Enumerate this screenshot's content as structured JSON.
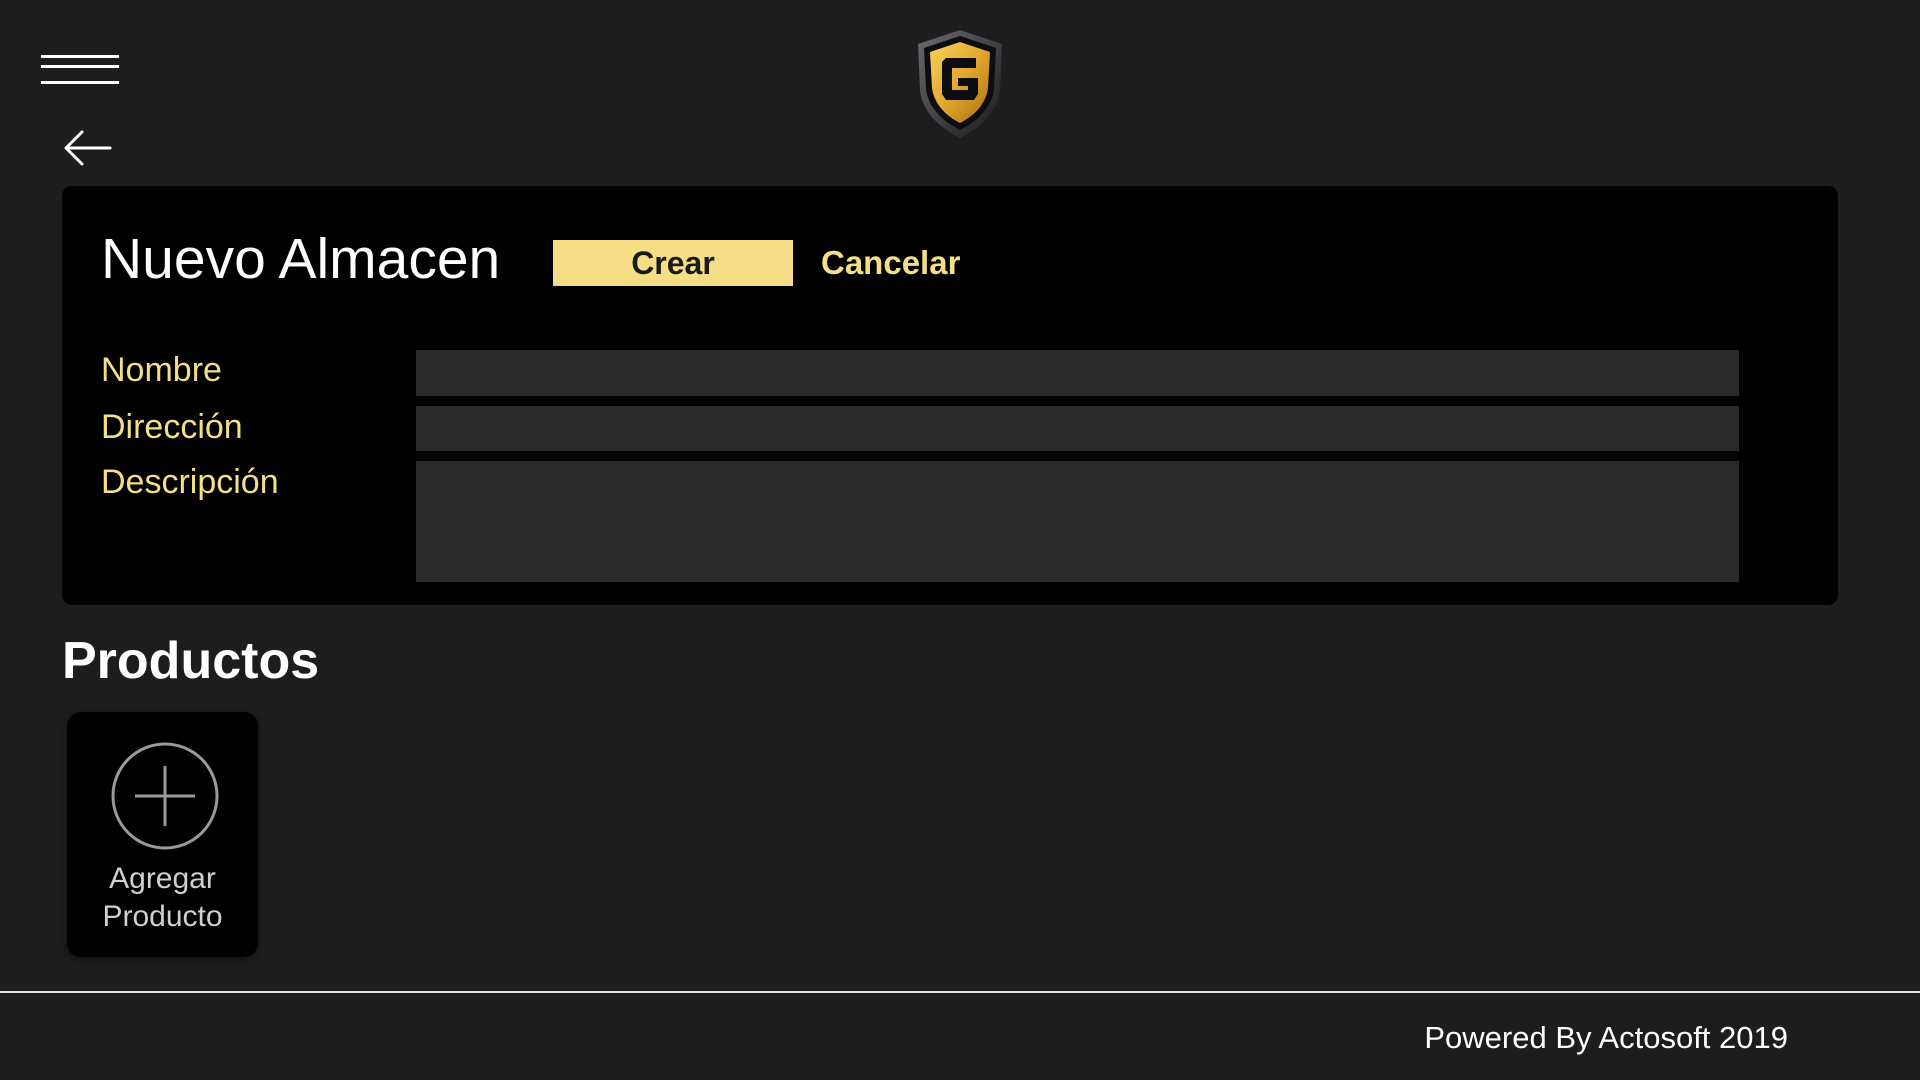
{
  "header": {
    "menu_icon": "hamburger-menu-icon",
    "logo_icon": "shield-g-logo",
    "back_icon": "arrow-left-icon"
  },
  "form": {
    "title": "Nuevo Almacen",
    "create_label": "Crear",
    "cancel_label": "Cancelar",
    "fields": [
      {
        "label": "Nombre",
        "value": "",
        "placeholder": ""
      },
      {
        "label": "Dirección",
        "value": "",
        "placeholder": ""
      },
      {
        "label": "Descripción",
        "value": "",
        "placeholder": ""
      }
    ]
  },
  "products": {
    "title": "Productos",
    "add_label_line1": "Agregar",
    "add_label_line2": "Producto",
    "add_icon": "plus-circle-icon"
  },
  "footer": {
    "text": "Powered By Actosoft 2019"
  },
  "colors": {
    "background": "#1d1d1e",
    "panel": "#000000",
    "accent": "#f5de85",
    "input": "#2a2a2b",
    "logo_gold": "#e2a72e"
  }
}
